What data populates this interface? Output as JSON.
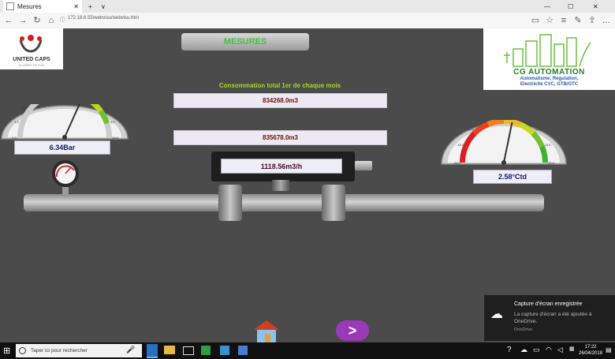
{
  "browser": {
    "tab_title": "Mesures",
    "new_tab_label": "+",
    "tab_menu": "∨",
    "url": "172.18.6.55/webvisu/webvisu.htm",
    "minimize": "—",
    "maximize": "☐",
    "close": "✕"
  },
  "header": {
    "title": "MESURES",
    "left_logo_text": "UNITED CAPS",
    "left_logo_tagline": "CLOSER TO YOU",
    "right_logo_name": "CG AUTOMATION",
    "right_logo_line1": "Automatisme, Régulation,",
    "right_logo_line2": "Electricité CVC, GTB/GTC"
  },
  "consumption": {
    "label": "Consommation total 1er de chaque mois",
    "value1": "834268.0m3",
    "value2": "835678.0m3",
    "flow": "1118.56m3/h"
  },
  "pressure": {
    "value": "6.34Bar",
    "unit": "Bar",
    "ticks": [
      "0.0",
      "1.0",
      "2.0",
      "3.0",
      "4.0",
      "5.0",
      "6.0",
      "7.0",
      "8.0",
      "9.0",
      "10.0"
    ],
    "needle_value": 6.34
  },
  "temperature": {
    "value": "2.58°Ctd",
    "ticks": [
      "-20.0",
      "-15.0",
      "-10.0",
      "-5.0",
      "0.0",
      "5.0",
      "10.0",
      "15.0",
      "20.0"
    ],
    "needle_value": 2.58
  },
  "nav": {
    "next_label": ">"
  },
  "taskbar": {
    "search_placeholder": "Taper ici pour rechercher",
    "time": "17:22",
    "date": "26/04/2018"
  },
  "notification": {
    "title": "Capture d'écran enregistrée",
    "body": "La capture d'écran a été ajoutée à OneDrive.",
    "source": "OneDrive"
  },
  "colors": {
    "title_green": "#3ec43e",
    "label_green": "#a8d820",
    "value_red": "#6a1010"
  }
}
